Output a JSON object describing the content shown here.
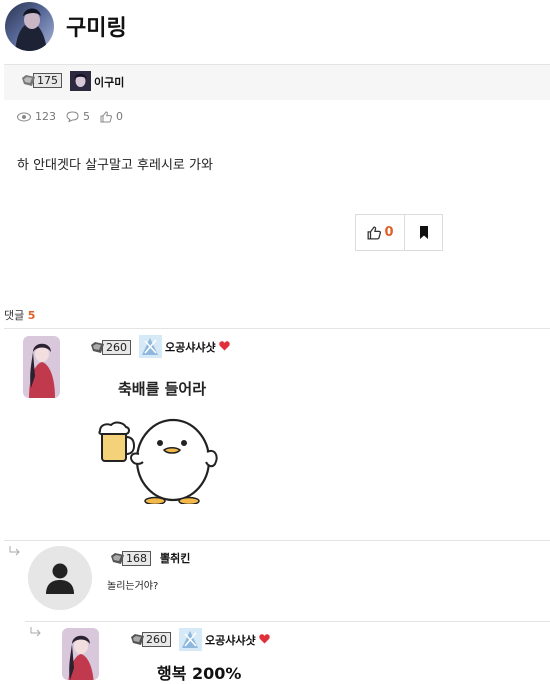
{
  "post": {
    "title": "구미링",
    "author": {
      "level": "175",
      "name": "이구미"
    },
    "stats": {
      "views": "123",
      "comments": "5",
      "likes": "0"
    },
    "body": "하 안대겟다 살구말고 후레시로 가와",
    "like_count": "0"
  },
  "comments": {
    "label": "댓글",
    "count": "5",
    "items": [
      {
        "level": "260",
        "name": "오공샤샤샷",
        "sticker_caption": "축배를 들어라"
      },
      {
        "level": "168",
        "name": "뽈취킨",
        "text": "놀리는거야?"
      },
      {
        "level": "260",
        "name": "오공샤샤샷",
        "sticker_caption": "행복 200%"
      }
    ]
  },
  "colors": {
    "accent": "#e0602a",
    "heart": "#e0303a",
    "bar_bg": "#f6f6f6"
  }
}
